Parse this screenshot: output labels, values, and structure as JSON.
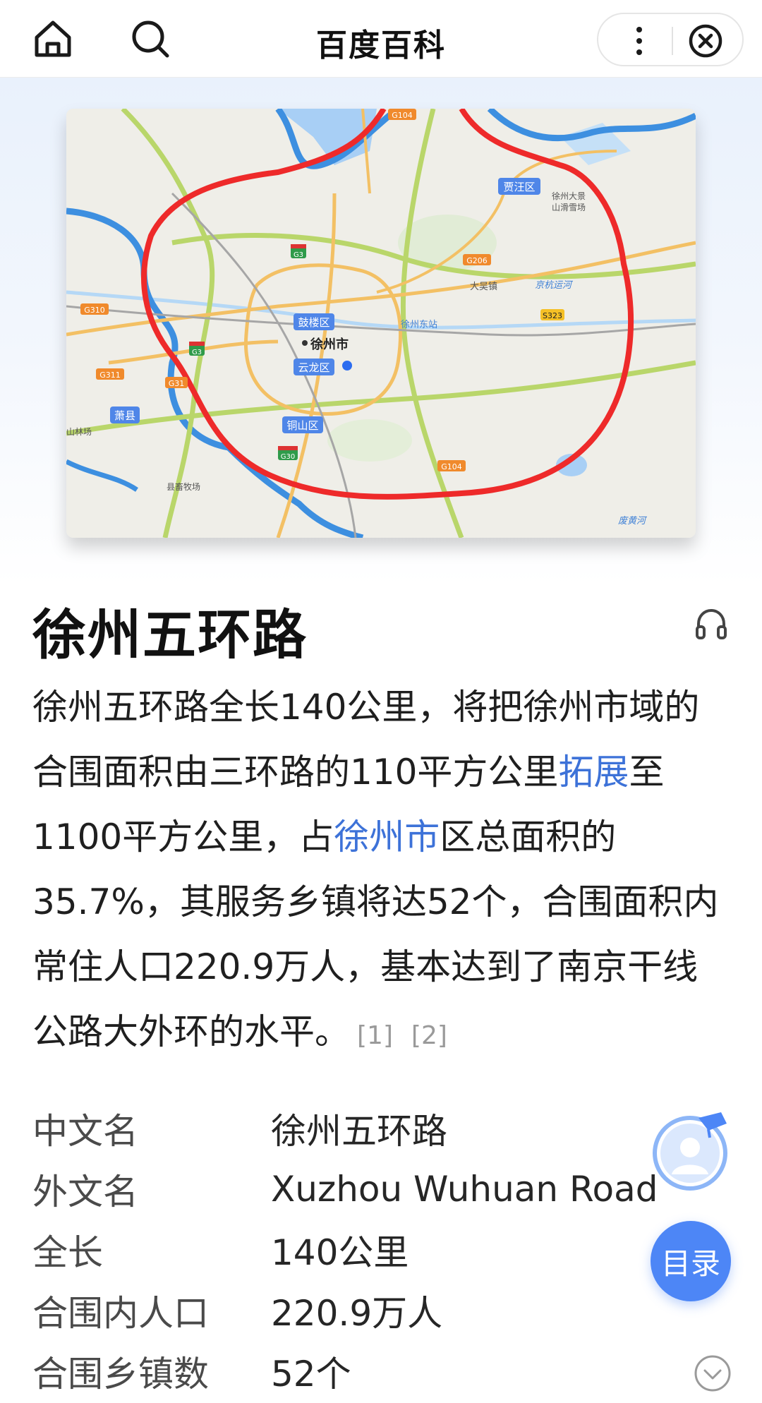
{
  "topbar": {
    "title": "百度百科",
    "home_icon": "home-icon",
    "search_icon": "search-icon",
    "more_icon": "more-vertical-icon",
    "close_icon": "close-circle-icon"
  },
  "map": {
    "labels": {
      "xuzhou_city": "徐州市",
      "gulou": "鼓楼区",
      "yunlong": "云龙区",
      "tongshan": "铜山区",
      "jiawang": "贾汪区",
      "xiaoxian": "萧县",
      "xuzhou_east": "徐州东站",
      "dawu": "大吴镇",
      "jinghang": "京杭运河",
      "dajing": "徐州大景",
      "shanhua": "山滑雪场",
      "feihuanghe": "废黄河",
      "linchang": "山林场",
      "muchang": "县畜牧场"
    },
    "shields": {
      "g104_top": "G104",
      "g3_top": "G3",
      "g206": "G206",
      "g310": "G310",
      "g3_left": "G3",
      "g311": "G311",
      "g31x": "G31",
      "s323": "S323",
      "g30": "G30",
      "g104_bottom": "G104"
    },
    "colors": {
      "ring": "#ee2a2a",
      "water": "#a8cff5",
      "border": "#3d8fe0",
      "highway": "#b9d66a",
      "road": "#f3c064",
      "district": "#4f86e8"
    }
  },
  "article": {
    "title": "徐州五环路",
    "audio_icon": "headphones-icon",
    "summary": {
      "p1": "徐州五环路全长140公里，将把徐州市域的合围面积由三环路的110平方公里",
      "link1": "拓展",
      "p2": "至1100平方公里，占",
      "link2": "徐州市",
      "p3": "区总面积的35.7%，其服务乡镇将达52个，合围面积内常住人口220.9万人，基本达到了南京干线公路大外环的水平。",
      "ref1": "[1]",
      "ref2": "[2]"
    }
  },
  "basic_info": [
    {
      "key": "中文名",
      "value": "徐州五环路"
    },
    {
      "key": "外文名",
      "value": "Xuzhou Wuhuan Road"
    },
    {
      "key": "全长",
      "value": "140公里"
    },
    {
      "key": "合围内人口",
      "value": "220.9万人"
    },
    {
      "key": "合围乡镇数",
      "value": "52个"
    }
  ],
  "floating": {
    "toc_label": "目录",
    "avatar_icon": "assistant-avatar-icon",
    "expand_icon": "chevron-down-circle-icon"
  }
}
